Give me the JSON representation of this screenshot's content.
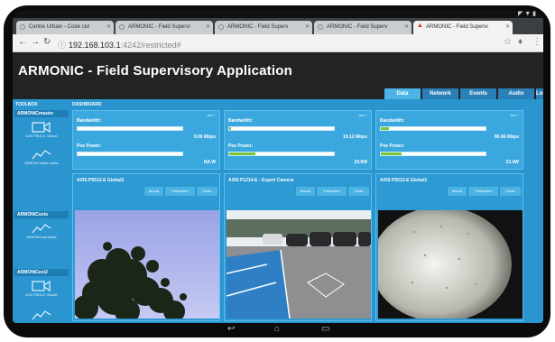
{
  "browser": {
    "tabs": [
      {
        "title": "Centre Urbain - Code civi",
        "active": false
      },
      {
        "title": "ARMONIC - Field Supervi",
        "active": false
      },
      {
        "title": "ARMONIC - Field Superv",
        "active": false
      },
      {
        "title": "ARMONIC - Field Superv",
        "active": false
      },
      {
        "title": "ARMONIC - Field Supervi",
        "active": true
      }
    ],
    "url_host": "192.168.103.1",
    "url_path": ":4242/restricted#"
  },
  "app": {
    "title": "ARMONIC - Field Supervisory Application",
    "nav_tabs": [
      "Data",
      "Network",
      "Events",
      "Audio",
      "Logout"
    ],
    "active_nav": "Data",
    "toolbox_label": "TOOLBOX",
    "dashboard_label": "DASHBOARD"
  },
  "toolbox": {
    "groups": [
      {
        "title": "ARMONICmaster",
        "items": [
          {
            "label": "AXIS P5512-E Global2",
            "icon": "camera-icon"
          },
          {
            "label": "ARMONICmaster status",
            "icon": "chart-line-icon"
          }
        ]
      },
      {
        "title": "ARMONICsolo",
        "items": [
          {
            "label": "ARMONICsolo status",
            "icon": "chart-line-icon"
          }
        ]
      },
      {
        "title": "ARMONICext2",
        "items": [
          {
            "label": "AXIS P5512-E Global1",
            "icon": "camera-icon"
          },
          {
            "label": "",
            "icon": "chart-line-icon"
          }
        ]
      }
    ]
  },
  "status_panels": [
    {
      "small": "Ant +",
      "bandwidth_label": "Bandwidth:",
      "bandwidth_value": "0.00 Mbps",
      "bandwidth_fill": 0.0,
      "power_label": "Poe Power:",
      "power_value": "NA W",
      "power_fill": 0.0
    },
    {
      "small": "Ant +",
      "bandwidth_label": "Bandwidth:",
      "bandwidth_value": "19.12 Mbps",
      "bandwidth_fill": 0.02,
      "power_label": "Poe Power:",
      "power_value": "20.6W",
      "power_fill": 0.25
    },
    {
      "small": "Ant +",
      "bandwidth_label": "Bandwidth:",
      "bandwidth_value": "86.66 Mbps",
      "bandwidth_fill": 0.08,
      "power_label": "Poe Power:",
      "power_value": "22.4W",
      "power_fill": 0.2
    }
  ],
  "cameras": [
    {
      "title": "AXIS P5512-E Global2",
      "buttons": [
        "record",
        "Fullscreen",
        "Close"
      ]
    },
    {
      "title": "AXIS P1214-E - Expert Camera",
      "buttons": [
        "record",
        "Fullscreen",
        "Close"
      ]
    },
    {
      "title": "AXIS P5512-E Global1",
      "buttons": [
        "record",
        "Fullscreen",
        "Close"
      ]
    }
  ],
  "colors": {
    "accent": "#2a95cf",
    "panel": "#3aa8de",
    "bar_fill": "#7ac83a",
    "header": "#222323"
  }
}
